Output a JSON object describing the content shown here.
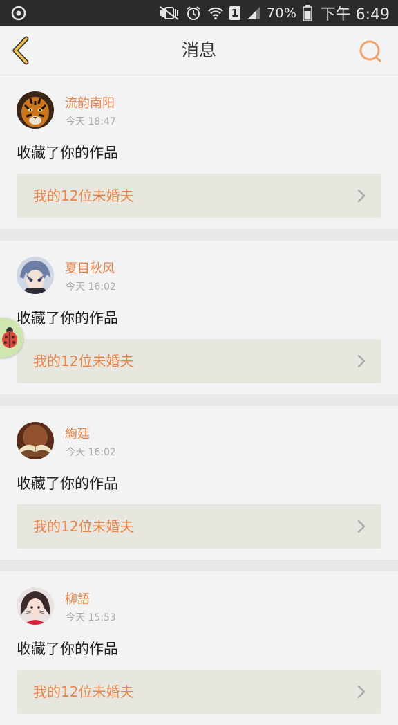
{
  "status_bar": {
    "battery": "70%",
    "time": "下午 6:49",
    "sim": "1"
  },
  "header": {
    "title": "消息",
    "icons": {
      "back": "back-arrow-icon",
      "search": "search-icon"
    }
  },
  "messages": [
    {
      "username": "流韵南阳",
      "time": "今天 18:47",
      "action": "收藏了你的作品",
      "work": "我的12位未婚夫",
      "avatar": "tiger-avatar"
    },
    {
      "username": "夏目秋风",
      "time": "今天 16:02",
      "action": "收藏了你的作品",
      "work": "我的12位未婚夫",
      "avatar": "anime-boy-avatar"
    },
    {
      "username": "絢廷",
      "time": "今天 16:02",
      "action": "收藏了你的作品",
      "work": "我的12位未婚夫",
      "avatar": "book-avatar"
    },
    {
      "username": "柳語",
      "time": "今天 15:53",
      "action": "收藏了你的作品",
      "work": "我的12位未婚夫",
      "avatar": "girl-avatar"
    }
  ],
  "colors": {
    "accent": "#e8844a",
    "status_bar": "#2b2b2b",
    "background": "#f3f3f3",
    "link_bg": "#e8e7df"
  }
}
